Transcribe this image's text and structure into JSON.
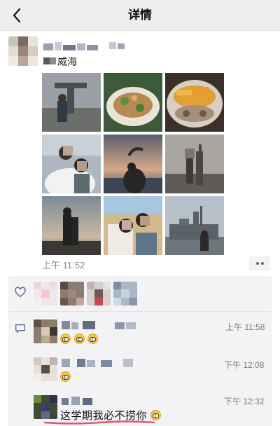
{
  "header": {
    "title": "详情"
  },
  "post": {
    "location": "威海",
    "time": "上午 11:52",
    "photo_count": 9
  },
  "comments": [
    {
      "time": "上午 11:58",
      "text": ""
    },
    {
      "time": "下午 12:08",
      "text": ""
    },
    {
      "time": "下午 12:32",
      "text": "这学期我必不捞你"
    }
  ],
  "colors": {
    "accent": "#5b6b8c",
    "underline": "#e0566b",
    "panel": "#f3f3f5"
  }
}
